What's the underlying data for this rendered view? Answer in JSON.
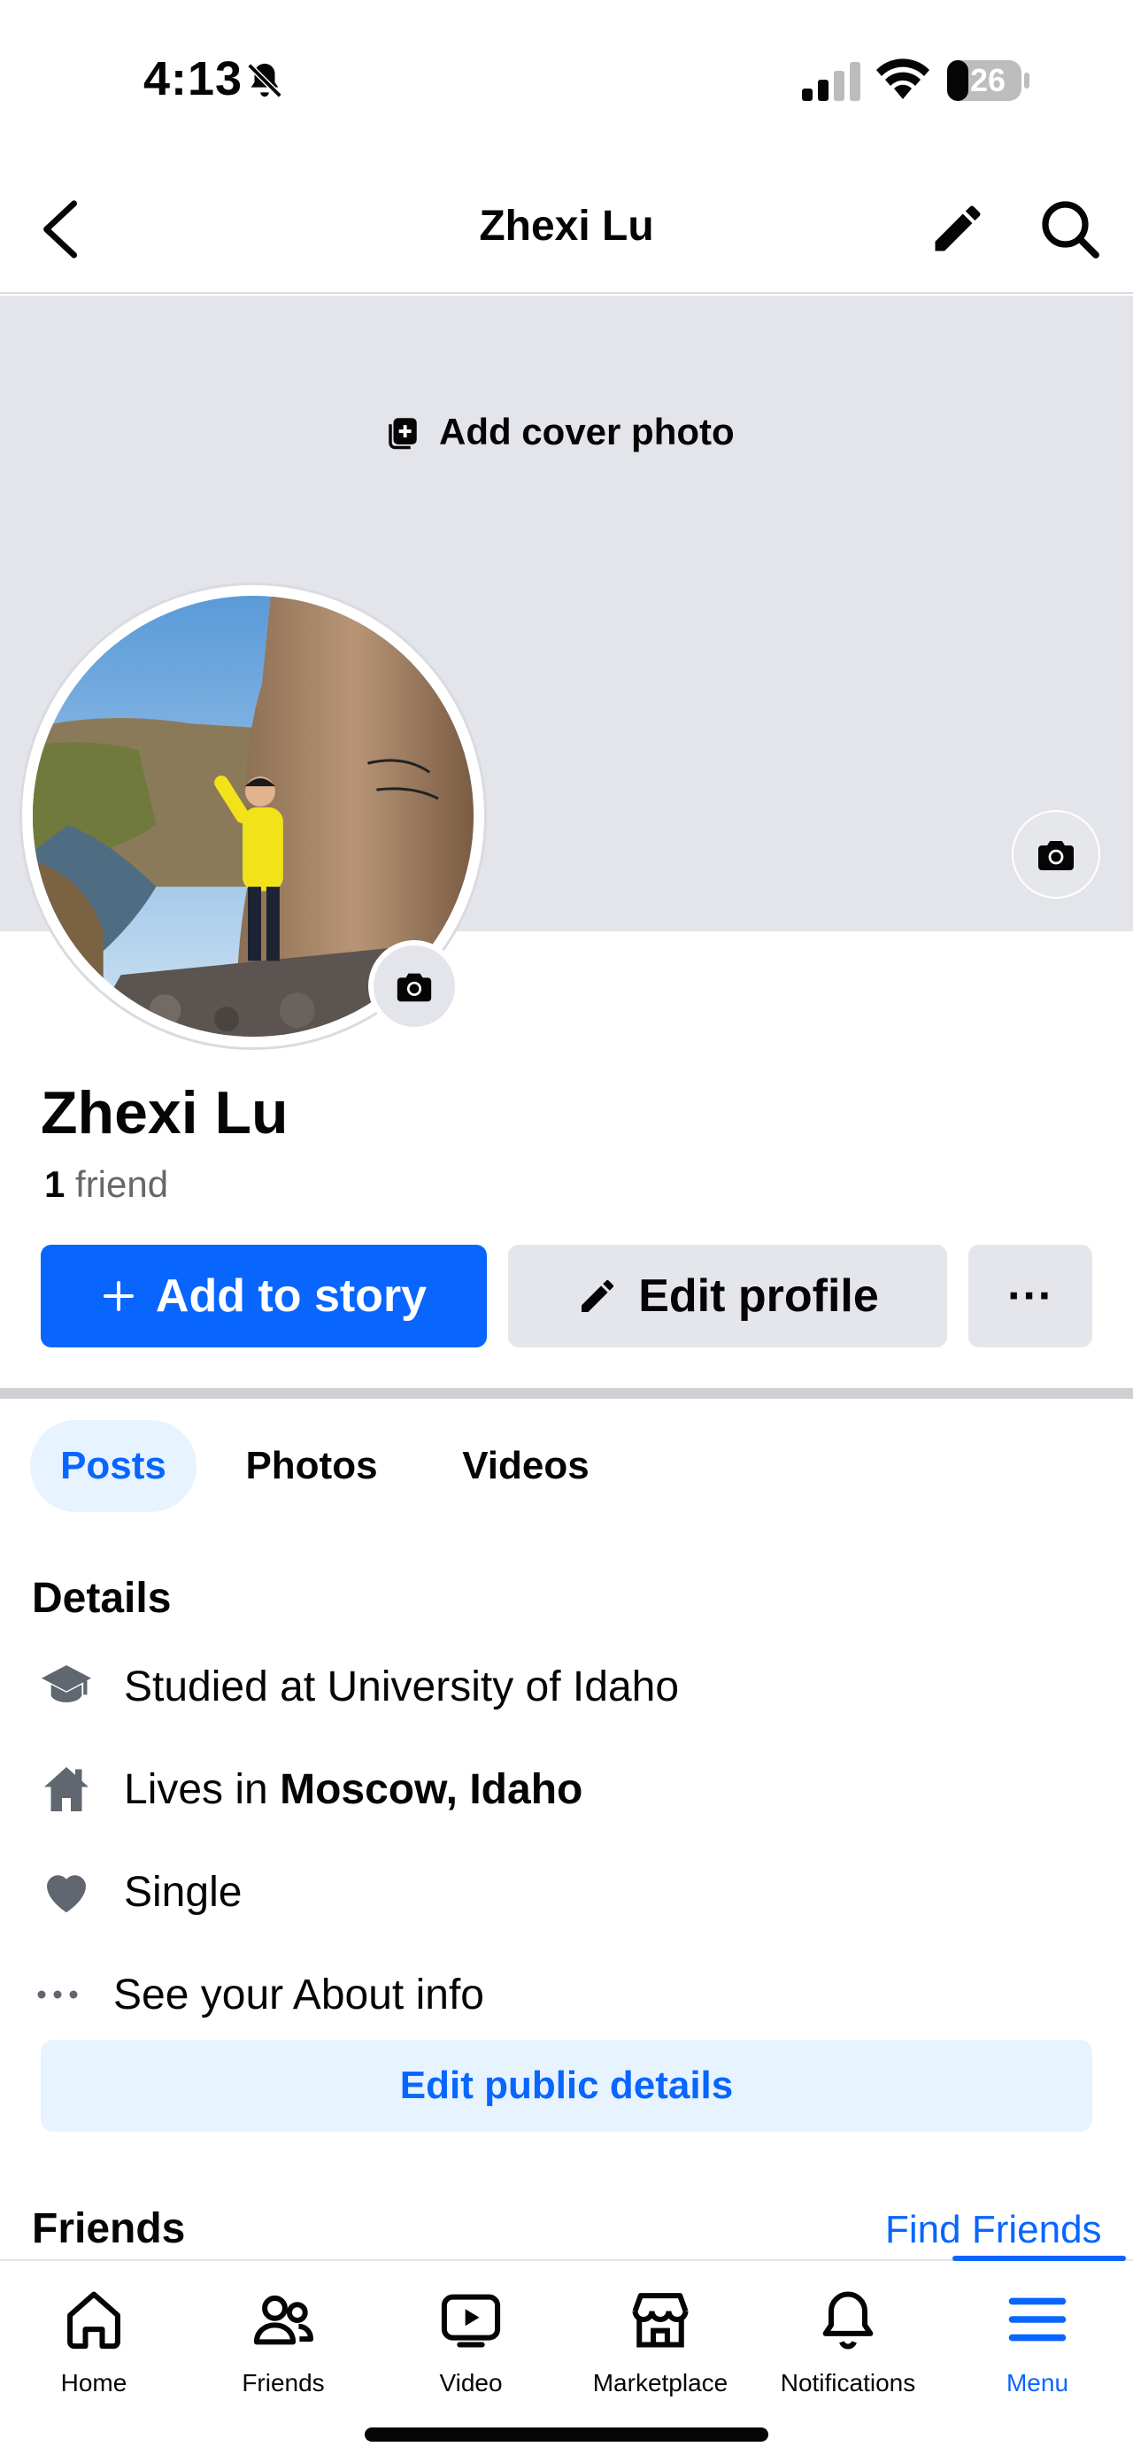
{
  "status_bar": {
    "time": "4:13",
    "battery": "26"
  },
  "header": {
    "title": "Zhexi Lu"
  },
  "cover": {
    "add_cover_label": "Add cover photo"
  },
  "profile": {
    "name": "Zhexi Lu",
    "friend_count": "1",
    "friend_word": "friend"
  },
  "actions": {
    "add_story": "Add to story",
    "edit_profile": "Edit profile",
    "more": "···"
  },
  "tabs": [
    {
      "label": "Posts",
      "active": true
    },
    {
      "label": "Photos"
    },
    {
      "label": "Videos"
    }
  ],
  "details": {
    "title": "Details",
    "studied": "Studied at University of Idaho",
    "lives_prefix": "Lives in ",
    "lives_place": "Moscow, Idaho",
    "relationship": "Single",
    "see_about": "See your About info",
    "edit_public": "Edit public details"
  },
  "friends": {
    "title": "Friends",
    "find_friends": "Find Friends"
  },
  "bottom_nav": [
    {
      "label": "Home",
      "icon": "home-icon"
    },
    {
      "label": "Friends",
      "icon": "friends-icon"
    },
    {
      "label": "Video",
      "icon": "video-icon"
    },
    {
      "label": "Marketplace",
      "icon": "marketplace-icon"
    },
    {
      "label": "Notifications",
      "icon": "bell-icon"
    },
    {
      "label": "Menu",
      "icon": "menu-icon",
      "active": true
    }
  ],
  "colors": {
    "accent": "#0866ff",
    "accent_light": "#e7f3ff",
    "cover_bg": "#e3e5ea",
    "button_gray": "#e4e6eb"
  }
}
